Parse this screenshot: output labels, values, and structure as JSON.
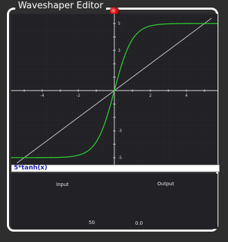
{
  "window": {
    "title": "Waveshaper Editor"
  },
  "formula": {
    "expression": "5*tanh(x)"
  },
  "io": {
    "input_label": "Input",
    "output_label": "Output",
    "input_value": "50",
    "output_value": "0.0"
  },
  "colors": {
    "curve": "#2fd12f",
    "identity_line": "#cfcfcf",
    "axes": "#dcdcdc",
    "knob": "#d11a1a"
  },
  "chart_data": {
    "type": "line",
    "title": "",
    "xlabel": "",
    "ylabel": "",
    "xlim": [
      -5.2,
      5.2
    ],
    "ylim": [
      -5.2,
      5.2
    ],
    "x_ticks": [
      "-4",
      "-2",
      "0",
      "2",
      "4"
    ],
    "y_ticks": [
      "5",
      "3",
      "-3",
      "-5"
    ],
    "series": [
      {
        "function": "5*tanh(x)",
        "color": "#2fd12f"
      },
      {
        "function": "x",
        "color": "#cfcfcf"
      }
    ],
    "grid": false
  }
}
